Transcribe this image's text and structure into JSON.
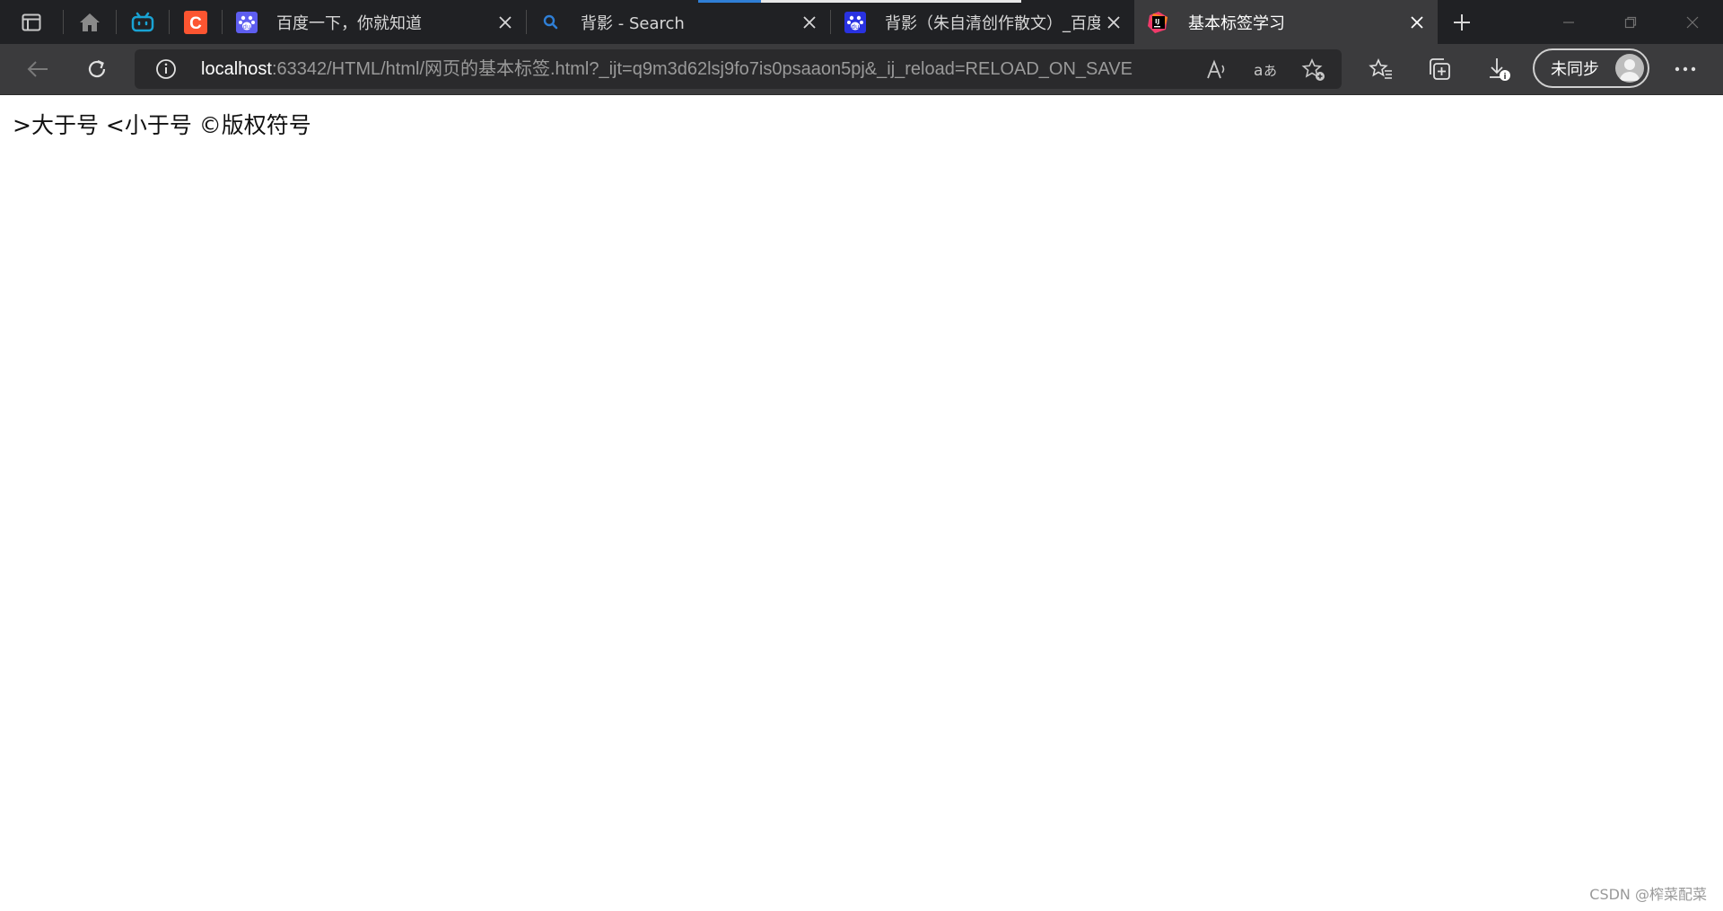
{
  "tabs": [
    {
      "title": "百度一下，你就知道",
      "favicon": "baidu-paw-icon",
      "active": false
    },
    {
      "title": "背影 - Search",
      "favicon": "bing-search-icon",
      "active": false,
      "loading": true
    },
    {
      "title": "背影（朱自清创作散文）_百度",
      "favicon": "baidu-paw-icon",
      "active": false
    },
    {
      "title": "基本标签学习",
      "favicon": "jetbrains-icon",
      "active": true
    }
  ],
  "address_bar": {
    "url_host": "localhost",
    "url_rest": ":63342/HTML/html/网页的基本标签.html?_ijt=q9m3d62lsj9fo7is0psaaon5pj&_ij_reload=RELOAD_ON_SAVE"
  },
  "profile": {
    "sync_label": "未同步"
  },
  "page": {
    "text": ">大于号 <小于号 ©版权符号"
  },
  "watermark": "CSDN @榨菜配菜",
  "colors": {
    "tabstrip_bg": "#202124",
    "toolbar_bg": "#3b3b3d",
    "csdn_orange": "#fc5531",
    "bilibili_teal": "#19a3d4",
    "loading_blue": "#2f7fd6"
  }
}
